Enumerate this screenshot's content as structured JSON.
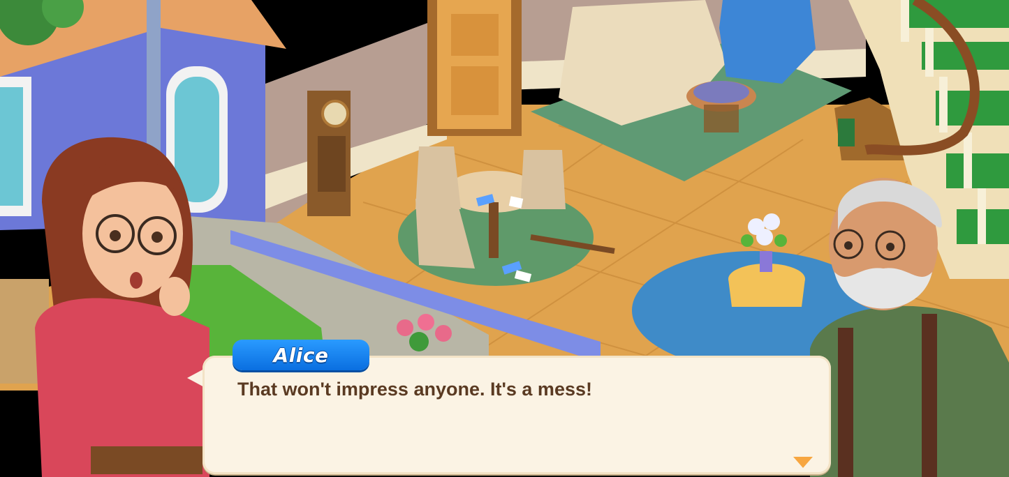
{
  "dialog": {
    "speaker": "Alice",
    "text": "That won't impress anyone. It's a mess!",
    "continue_icon": "triangle-down-icon"
  },
  "colors": {
    "name_tag": "#1f86f0",
    "dialog_bg": "#fbf3e4",
    "dialog_text": "#5a3a22",
    "continue_arrow": "#f7a640"
  }
}
